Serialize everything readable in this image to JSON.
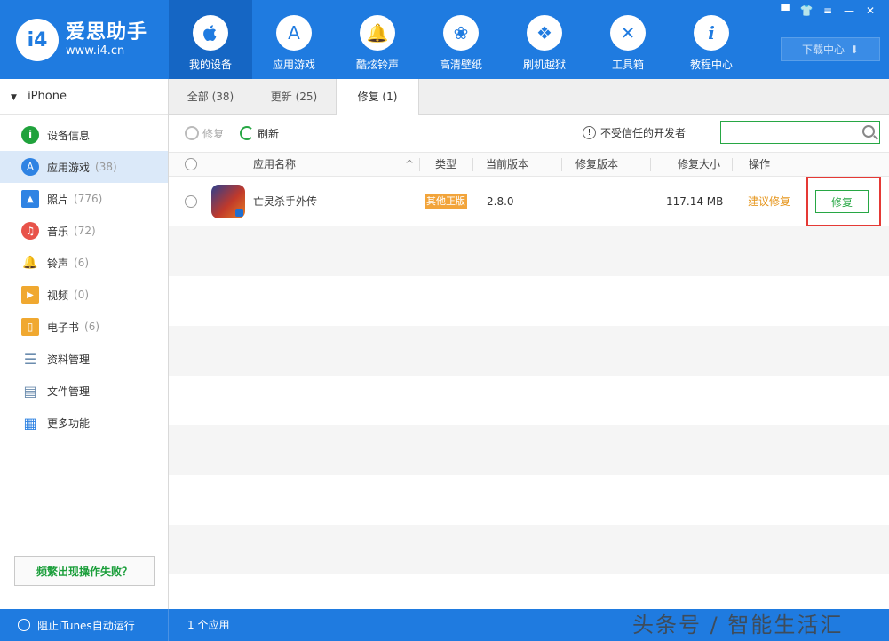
{
  "brand": {
    "name": "爱思助手",
    "url": "www.i4.cn",
    "badge": "i4"
  },
  "nav": [
    {
      "label": "我的设备",
      "icon": "apple-icon",
      "glyph": ""
    },
    {
      "label": "应用游戏",
      "icon": "appstore-icon",
      "glyph": "A"
    },
    {
      "label": "酷炫铃声",
      "icon": "bell-icon",
      "glyph": "🔔"
    },
    {
      "label": "高清壁纸",
      "icon": "flower-icon",
      "glyph": "❀"
    },
    {
      "label": "刷机越狱",
      "icon": "dropbox-icon",
      "glyph": "❖"
    },
    {
      "label": "工具箱",
      "icon": "tools-icon",
      "glyph": "✕"
    },
    {
      "label": "教程中心",
      "icon": "info-icon",
      "glyph": "i"
    }
  ],
  "window_controls": [
    "▀",
    "👕",
    "≡",
    "—",
    "✕"
  ],
  "download": {
    "label": "下载中心",
    "arrow": "⬇"
  },
  "device": {
    "name": "iPhone",
    "toggle": "▼"
  },
  "sidebar": [
    {
      "label": "设备信息",
      "count": "",
      "icon": "device-info-icon",
      "color": "#20a23c",
      "glyph": "i"
    },
    {
      "label": "应用游戏",
      "count": "(38)",
      "icon": "apps-icon",
      "color": "#2f83e3",
      "glyph": "A"
    },
    {
      "label": "照片",
      "count": "(776)",
      "icon": "photo-icon",
      "color": "#2f83e3",
      "glyph": "▲"
    },
    {
      "label": "音乐",
      "count": "(72)",
      "icon": "music-icon",
      "color": "#e8534a",
      "glyph": "♫"
    },
    {
      "label": "铃声",
      "count": "(6)",
      "icon": "ringtone-icon",
      "color": "#2f83e3",
      "glyph": "🔔"
    },
    {
      "label": "视频",
      "count": "(0)",
      "icon": "video-icon",
      "color": "#f0a830",
      "glyph": "▶"
    },
    {
      "label": "电子书",
      "count": "(6)",
      "icon": "ebook-icon",
      "color": "#f0a830",
      "glyph": "▯"
    },
    {
      "label": "资料管理",
      "count": "",
      "icon": "data-icon",
      "color": "#6b8cae",
      "glyph": "☰"
    },
    {
      "label": "文件管理",
      "count": "",
      "icon": "file-icon",
      "color": "#6b8cae",
      "glyph": "▤"
    },
    {
      "label": "更多功能",
      "count": "",
      "icon": "more-icon",
      "color": "#2f83e3",
      "glyph": "▦"
    }
  ],
  "help": "频繁出现操作失败？",
  "tabs": [
    "全部 (38)",
    "更新 (25)",
    "修复 (1)"
  ],
  "toolbar": {
    "repair": "修复",
    "refresh": "刷新",
    "untrusted": "不受信任的开发者",
    "untrusted_glyph": "!",
    "search_placeholder": ""
  },
  "columns": {
    "name": "应用名称",
    "sort": "^",
    "type": "类型",
    "current": "当前版本",
    "repair_ver": "修复版本",
    "size": "修复大小",
    "action": "操作"
  },
  "rows": [
    {
      "name": "亡灵杀手外传",
      "type": "其他正版",
      "current": "2.8.0",
      "repair_ver": "",
      "size": "117.14 MB",
      "suggest": "建议修复",
      "action": "修复"
    }
  ],
  "status": {
    "itunes": "阻止iTunes自动运行",
    "count": "1 个应用"
  },
  "watermark": "头条号 / 智能生活汇"
}
